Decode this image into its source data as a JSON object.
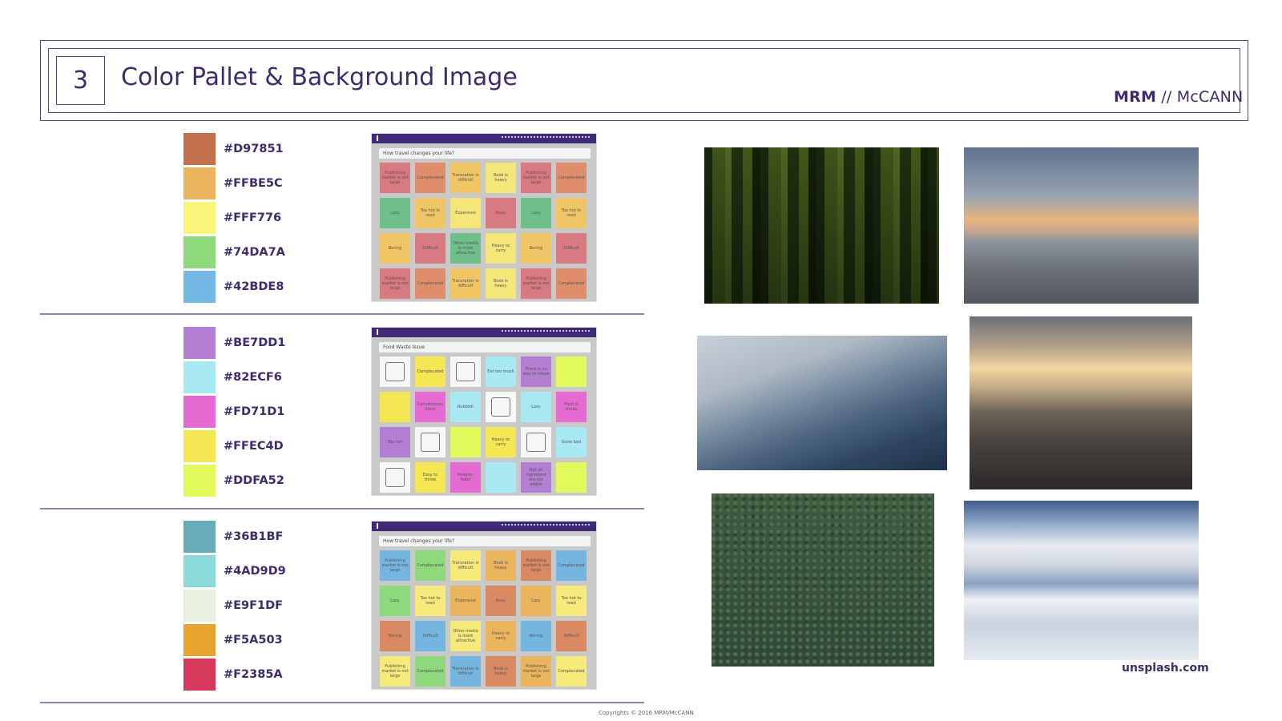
{
  "header": {
    "section_number": "3",
    "title": "Color Pallet & Background Image",
    "logo_bold": "MRM",
    "logo_sep": " // ",
    "logo_light": "McCANN"
  },
  "palettes": [
    {
      "colors": [
        "#D97851",
        "#FFBE5C",
        "#FFF776",
        "#74DA7A",
        "#42BDE8"
      ],
      "swatches": [
        "#c2714c",
        "#eab55c",
        "#f9f57b",
        "#8dd97c",
        "#74b9e6"
      ],
      "mock": {
        "question": "How travel changes your life?",
        "notes": [
          {
            "t": "Publishing market is not large",
            "c": "#d97a82"
          },
          {
            "t": "Complecated",
            "c": "#e08d6c"
          },
          {
            "t": "Transration is difficult",
            "c": "#f0c665"
          },
          {
            "t": "Book is heavy",
            "c": "#f5e67a"
          },
          {
            "t": "Publishing market is not large",
            "c": "#d97a82"
          },
          {
            "t": "Complecated",
            "c": "#e08d6c"
          },
          {
            "t": "Lazy",
            "c": "#6fbf8a"
          },
          {
            "t": "Too hot to read",
            "c": "#f0c665"
          },
          {
            "t": "Expensive",
            "c": "#f5e67a"
          },
          {
            "t": "Busy",
            "c": "#d97a82"
          },
          {
            "t": "Lazy",
            "c": "#6fbf8a"
          },
          {
            "t": "Too hot to read",
            "c": "#f0c665"
          },
          {
            "t": "Boring",
            "c": "#f0c665"
          },
          {
            "t": "Difficult",
            "c": "#d97a82"
          },
          {
            "t": "Other media is more attractive",
            "c": "#6fbf8a"
          },
          {
            "t": "Heavy to carry",
            "c": "#f5e67a"
          },
          {
            "t": "Boring",
            "c": "#f0c665"
          },
          {
            "t": "Difficult",
            "c": "#d97a82"
          },
          {
            "t": "Publishing market is not large",
            "c": "#d97a82"
          },
          {
            "t": "Complecated",
            "c": "#e08d6c"
          },
          {
            "t": "Transration is difficult",
            "c": "#f0c665"
          },
          {
            "t": "Book is heavy",
            "c": "#f5e67a"
          },
          {
            "t": "Publishing market is not large",
            "c": "#d97a82"
          },
          {
            "t": "Complecated",
            "c": "#e08d6c"
          }
        ]
      }
    },
    {
      "colors": [
        "#BE7DD1",
        "#82ECF6",
        "#FD71D1",
        "#FFEC4D",
        "#DDFA52"
      ],
      "swatches": [
        "#b47fd2",
        "#a8e8f3",
        "#e56bd3",
        "#f5e654",
        "#e2f95c"
      ],
      "mock": {
        "question": "Food Waste Issue",
        "notes": [
          {
            "t": "",
            "c": "img"
          },
          {
            "t": "Complecated",
            "c": "#f5e654"
          },
          {
            "t": "",
            "c": "img"
          },
          {
            "t": "Eat too much",
            "c": "#a8e8f3"
          },
          {
            "t": "There is no way to chose",
            "c": "#b47fd2"
          },
          {
            "t": "",
            "c": "#e2f95c"
          },
          {
            "t": "",
            "c": "#f5e654"
          },
          {
            "t": "Convenience Store",
            "c": "#e56bd3"
          },
          {
            "t": "Rubbish",
            "c": "#a8e8f3"
          },
          {
            "t": "",
            "c": "img"
          },
          {
            "t": "Lazy",
            "c": "#a8e8f3"
          },
          {
            "t": "Food is cheap",
            "c": "#e56bd3"
          },
          {
            "t": "Too hot",
            "c": "#b47fd2"
          },
          {
            "t": "",
            "c": "img"
          },
          {
            "t": "",
            "c": "#e2f95c"
          },
          {
            "t": "Heavy to carry",
            "c": "#f5e654"
          },
          {
            "t": "",
            "c": "img"
          },
          {
            "t": "Gone bad",
            "c": "#a8e8f3"
          },
          {
            "t": "",
            "c": "img"
          },
          {
            "t": "Easy to throw",
            "c": "#f5e654"
          },
          {
            "t": "Religion Habit",
            "c": "#e56bd3"
          },
          {
            "t": "",
            "c": "#a8e8f3"
          },
          {
            "t": "Not all ingredient are not edible",
            "c": "#b47fd2"
          },
          {
            "t": "",
            "c": "#e2f95c"
          }
        ]
      }
    },
    {
      "colors": [
        "#36B1BF",
        "#4AD9D9",
        "#E9F1DF",
        "#F5A503",
        "#F2385A"
      ],
      "swatches": [
        "#66adb9",
        "#8bd9d9",
        "#e8f0e0",
        "#e6a32e",
        "#d6395b"
      ],
      "mock": {
        "question": "How travel changes your life?",
        "notes": [
          {
            "t": "Publishing market is not large",
            "c": "#74b6e0"
          },
          {
            "t": "Complecated",
            "c": "#8dd97c"
          },
          {
            "t": "Transration is difficult",
            "c": "#f5ea7a"
          },
          {
            "t": "Book is heavy",
            "c": "#eab55c"
          },
          {
            "t": "Publishing market is not large",
            "c": "#d98a62"
          },
          {
            "t": "Complecated",
            "c": "#74b6e0"
          },
          {
            "t": "Lazy",
            "c": "#8dd97c"
          },
          {
            "t": "Too hot to read",
            "c": "#f5ea7a"
          },
          {
            "t": "Expensive",
            "c": "#eab55c"
          },
          {
            "t": "Busy",
            "c": "#d98a62"
          },
          {
            "t": "Lazy",
            "c": "#eab55c"
          },
          {
            "t": "Too hot to read",
            "c": "#f5ea7a"
          },
          {
            "t": "Boring",
            "c": "#d98a62"
          },
          {
            "t": "Difficult",
            "c": "#74b6e0"
          },
          {
            "t": "Other media is more attractive",
            "c": "#f5ea7a"
          },
          {
            "t": "Heavy to carry",
            "c": "#eab55c"
          },
          {
            "t": "Boring",
            "c": "#74b6e0"
          },
          {
            "t": "Difficult",
            "c": "#d98a62"
          },
          {
            "t": "Publishing market is not large",
            "c": "#f5ea7a"
          },
          {
            "t": "Complecated",
            "c": "#8dd97c"
          },
          {
            "t": "Transration is difficult",
            "c": "#74b6e0"
          },
          {
            "t": "Book is heavy",
            "c": "#d98a62"
          },
          {
            "t": "Publishing market is not large",
            "c": "#eab55c"
          },
          {
            "t": "Complecated",
            "c": "#f5ea7a"
          }
        ]
      }
    }
  ],
  "photos": [
    "bamboo",
    "sunset-sea",
    "mountain-haze",
    "city-skyline",
    "pine-forest",
    "sky-reflection"
  ],
  "credit": "unsplash.com",
  "copyright": "Copyrights © 2016 MRM/McCANN"
}
